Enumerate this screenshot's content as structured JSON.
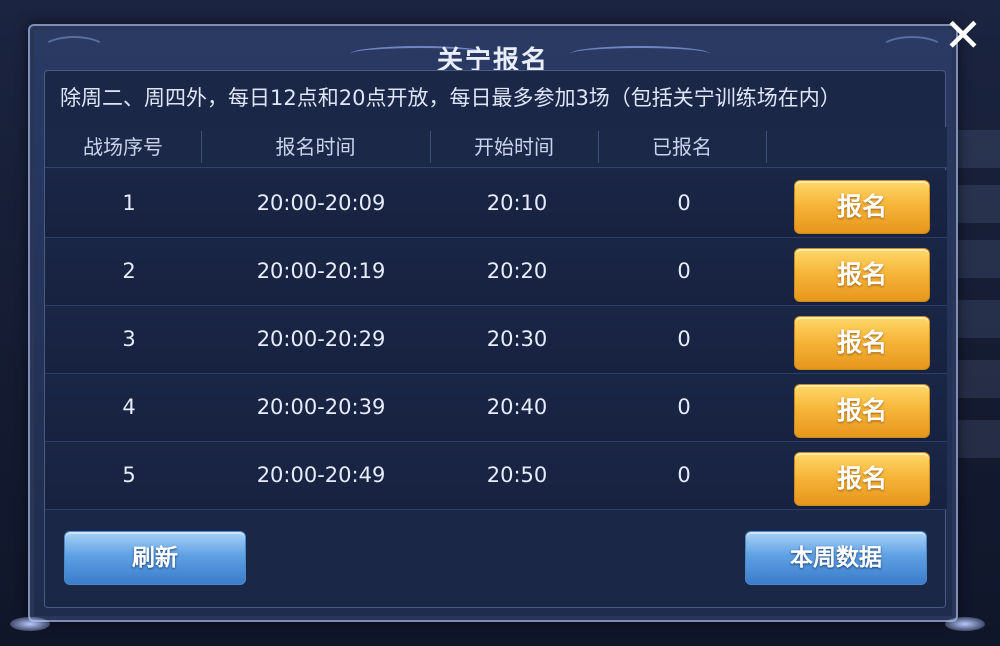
{
  "dialog": {
    "title": "关宁报名",
    "close_symbol": "✕",
    "notice": "除周二、周四外，每日12点和20点开放，每日最多参加3场（包括关宁训练场在内）"
  },
  "table": {
    "headers": [
      "战场序号",
      "报名时间",
      "开始时间",
      "已报名"
    ],
    "rows": [
      {
        "index": "1",
        "signup_time": "20:00-20:09",
        "start_time": "20:10",
        "registered": "0",
        "button": "报名"
      },
      {
        "index": "2",
        "signup_time": "20:00-20:19",
        "start_time": "20:20",
        "registered": "0",
        "button": "报名"
      },
      {
        "index": "3",
        "signup_time": "20:00-20:29",
        "start_time": "20:30",
        "registered": "0",
        "button": "报名"
      },
      {
        "index": "4",
        "signup_time": "20:00-20:39",
        "start_time": "20:40",
        "registered": "0",
        "button": "报名"
      },
      {
        "index": "5",
        "signup_time": "20:00-20:49",
        "start_time": "20:50",
        "registered": "0",
        "button": "报名"
      }
    ]
  },
  "footer": {
    "refresh_label": "刷新",
    "weekly_data_label": "本周数据"
  },
  "colors": {
    "accent_orange": "#f6b63a",
    "accent_blue": "#5fa1e3",
    "panel": "#1b2746"
  },
  "icons": {
    "close": "close-icon"
  }
}
